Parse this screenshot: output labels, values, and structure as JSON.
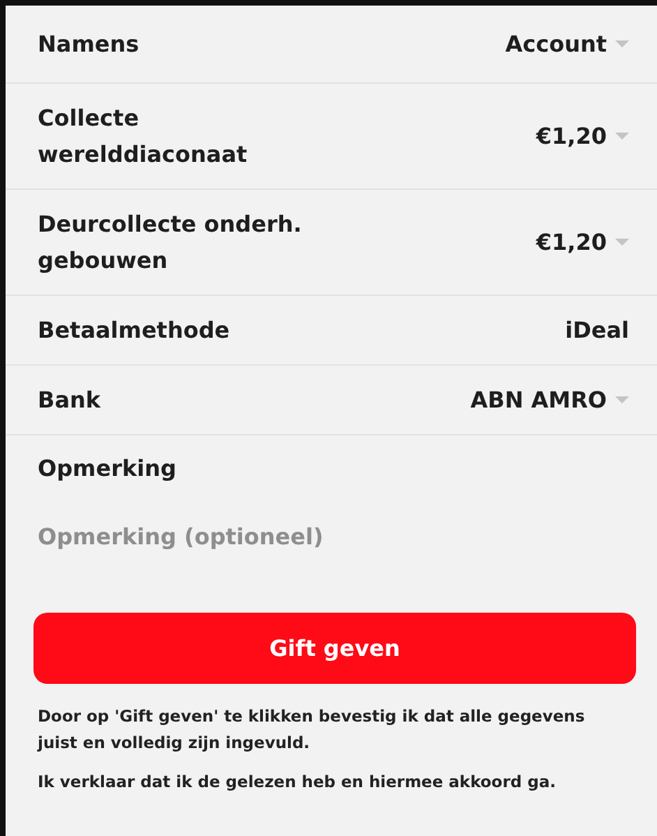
{
  "fields": [
    {
      "label": "Namens",
      "value": "Account",
      "kind": "dropdown"
    },
    {
      "label": "Collecte werelddiaconaat",
      "value": "€1,20",
      "kind": "dropdown"
    },
    {
      "label": "Deurcollecte onderh. gebouwen",
      "value": "€1,20",
      "kind": "dropdown"
    },
    {
      "label": "Betaalmethode",
      "value": "iDeal",
      "kind": "static"
    },
    {
      "label": "Bank",
      "value": "ABN AMRO",
      "kind": "dropdown"
    }
  ],
  "remark": {
    "label": "Opmerking",
    "placeholder": "Opmerking (optioneel)"
  },
  "submit_button": "Gift geven",
  "disclaimers": [
    "Door op 'Gift geven' te klikken bevestig ik dat alle gegevens juist en volledig zijn ingevuld.",
    "Ik verklaar dat ik de gelezen heb en hiermee akkoord ga."
  ]
}
